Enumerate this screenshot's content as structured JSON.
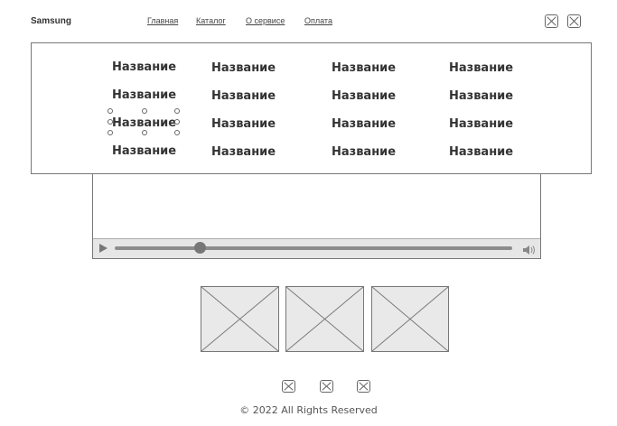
{
  "header": {
    "brand": "Samsung",
    "nav": [
      "Главная",
      "Каталог",
      "О сервисе",
      "Оплата"
    ],
    "icons": [
      "image-placeholder-icon",
      "image-placeholder-icon"
    ]
  },
  "catalog_menu": {
    "rows": [
      [
        "Название",
        "Название",
        "Название",
        "Название"
      ],
      [
        "Название",
        "Название",
        "Название",
        "Название"
      ],
      [
        "Название",
        "Название",
        "Название",
        "Название"
      ],
      [
        "Название",
        "Название",
        "Название",
        "Название"
      ]
    ],
    "selected_cell": "row 3, column 1"
  },
  "video_player": {
    "play_icon": "play-icon",
    "volume_icon": "volume-icon",
    "progress": 0.2
  },
  "gallery": {
    "images": [
      "image-placeholder",
      "image-placeholder",
      "image-placeholder"
    ]
  },
  "social_icons": [
    "image-placeholder-icon",
    "image-placeholder-icon",
    "image-placeholder-icon"
  ],
  "footer": {
    "copyright": "© 2022 All Rights Reserved"
  },
  "colors": {
    "border": "#777777",
    "control_bar": "#e6e6e6",
    "placeholder_fill": "#e9e9e9"
  }
}
